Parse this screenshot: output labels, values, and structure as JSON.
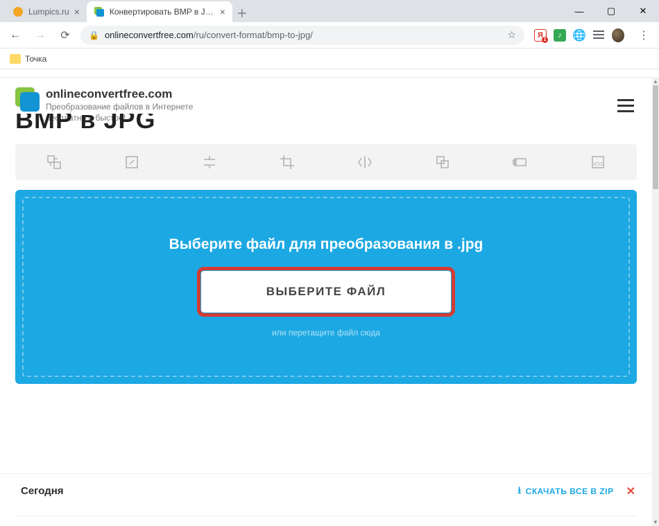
{
  "window": {
    "tabs": [
      {
        "title": "Lumpics.ru",
        "active": false
      },
      {
        "title": "Конвертировать BMP в JPG онл",
        "active": true
      }
    ],
    "url_domain": "onlineconvertfree.com",
    "url_path": "/ru/convert-format/bmp-to-jpg/",
    "ext_badge": "1"
  },
  "bookmarks": {
    "item1": "Точка"
  },
  "brand": {
    "name": "onlineconvertfree.com",
    "tagline_l1": "Преобразование файлов в Интернете",
    "tagline_l2": "бесплатно и быстро!"
  },
  "page": {
    "title_cut": "BMP в JPG"
  },
  "upload": {
    "title": "Выберите файл для преобразования в .jpg",
    "button": "ВЫБЕРИТЕ ФАЙЛ",
    "hint": "или перетащите файл сюда"
  },
  "bottom": {
    "today": "Сегодня",
    "download_all": "СКАЧАТЬ ВСЕ В ZIP"
  }
}
